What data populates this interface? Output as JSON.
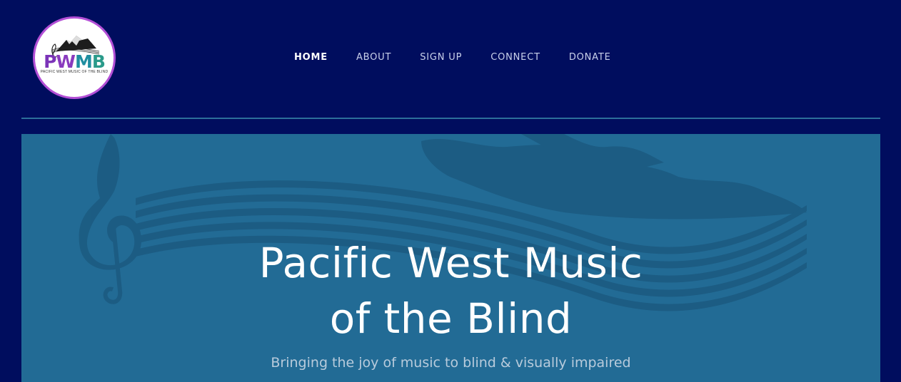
{
  "logo": {
    "letters": [
      "P",
      "W",
      "M",
      "B"
    ],
    "subtitle": "PACIFIC WEST MUSIC OF THE BLIND"
  },
  "nav": {
    "items": [
      {
        "label": "HOME",
        "active": true
      },
      {
        "label": "ABOUT",
        "active": false
      },
      {
        "label": "SIGN UP",
        "active": false
      },
      {
        "label": "CONNECT",
        "active": false
      },
      {
        "label": "DONATE",
        "active": false
      }
    ]
  },
  "hero": {
    "title_line1": "Pacific West Music",
    "title_line2": "of the Blind",
    "subtitle": "Bringing the joy of music to blind & visually impaired"
  },
  "colors": {
    "page_bg": "#000d5e",
    "hero_bg": "#226b95",
    "divider": "#2c6f9a",
    "logo_ring": "#b34fd6"
  }
}
